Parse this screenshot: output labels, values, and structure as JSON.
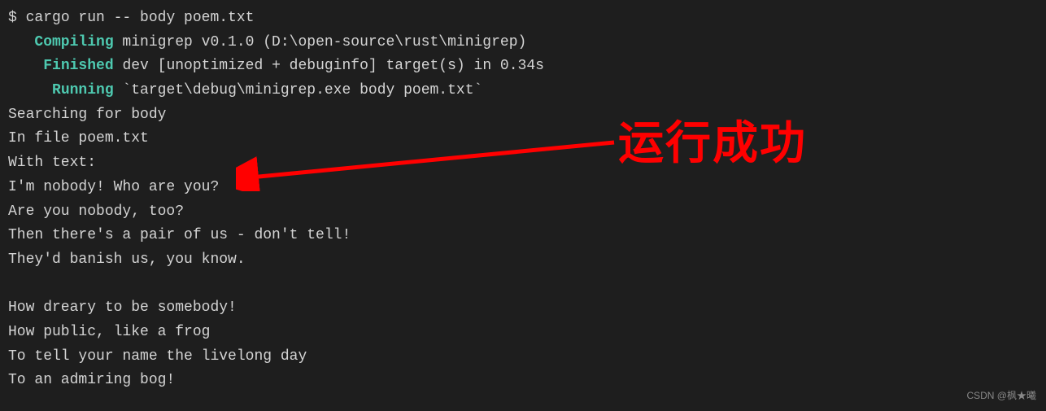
{
  "terminal": {
    "prompt": "$ ",
    "command": "cargo run -- body poem.txt",
    "compiling_label": "Compiling",
    "compiling_text": " minigrep v0.1.0 (D:\\open-source\\rust\\minigrep)",
    "finished_label": "Finished",
    "finished_text": " dev [unoptimized + debuginfo] target(s) in 0.34s",
    "running_label": "Running",
    "running_text": " `target\\debug\\minigrep.exe body poem.txt`",
    "output": [
      "Searching for body",
      "In file poem.txt",
      "With text:",
      "I'm nobody! Who are you?",
      "Are you nobody, too?",
      "Then there's a pair of us - don't tell!",
      "They'd banish us, you know.",
      "",
      "How dreary to be somebody!",
      "How public, like a frog",
      "To tell your name the livelong day",
      "To an admiring bog!"
    ]
  },
  "annotation": {
    "text": "运行成功",
    "color": "#ff0000"
  },
  "watermark": "CSDN @枫★曦"
}
